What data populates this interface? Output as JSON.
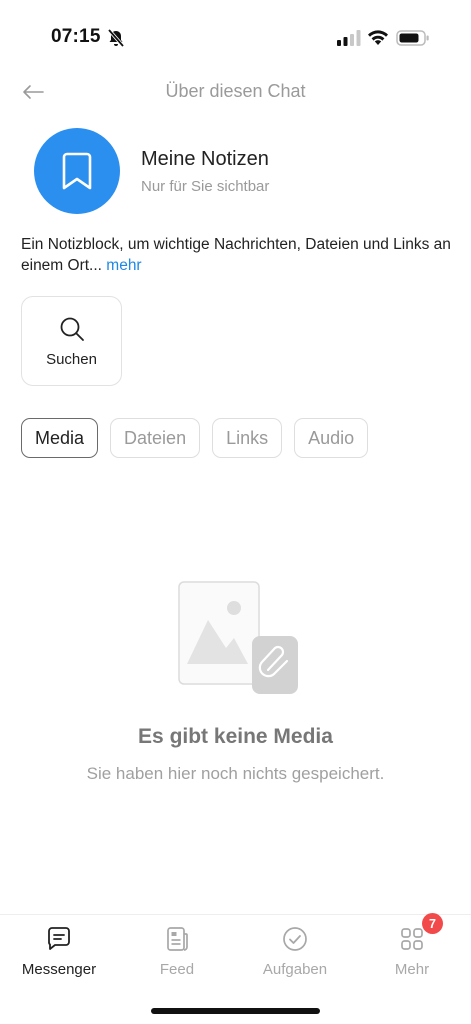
{
  "status_bar": {
    "time": "07:15"
  },
  "header": {
    "title": "Über diesen Chat"
  },
  "profile": {
    "name": "Meine Notizen",
    "subtitle": "Nur für Sie sichtbar",
    "avatar_color": "#2b8ff0"
  },
  "description": {
    "text": "Ein Notizblock, um wichtige Nachrichten, Dateien und Links an einem Ort...",
    "more_label": "mehr"
  },
  "actions": {
    "search_label": "Suchen"
  },
  "tabs": [
    {
      "label": "Media",
      "active": true
    },
    {
      "label": "Dateien",
      "active": false
    },
    {
      "label": "Links",
      "active": false
    },
    {
      "label": "Audio",
      "active": false
    }
  ],
  "empty_state": {
    "title": "Es gibt keine Media",
    "subtitle": "Sie haben hier noch nichts gespeichert."
  },
  "bottom_nav": [
    {
      "label": "Messenger",
      "icon": "chat-icon",
      "active": true
    },
    {
      "label": "Feed",
      "icon": "feed-icon",
      "active": false
    },
    {
      "label": "Aufgaben",
      "icon": "check-circle-icon",
      "active": false
    },
    {
      "label": "Mehr",
      "icon": "grid-icon",
      "active": false,
      "badge": "7"
    }
  ],
  "colors": {
    "accent": "#2b8ff0",
    "link": "#1e88e5",
    "badge": "#f24a4a"
  }
}
